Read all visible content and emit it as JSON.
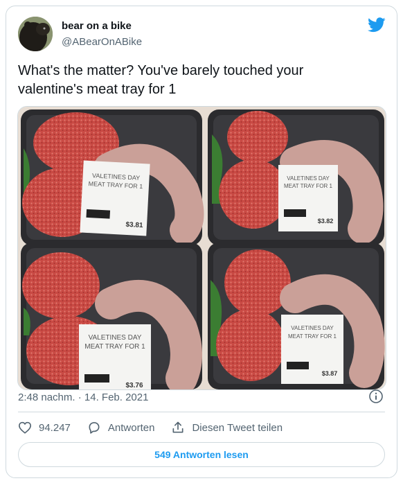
{
  "author": {
    "display_name": "bear on a bike",
    "handle": "@ABearOnABike"
  },
  "tweet": {
    "text_line1": "What's the matter? You've barely touched your",
    "text_line2": "valentine's meat tray for 1",
    "timestamp": "2:48 nachm. · 14. Feb. 2021"
  },
  "media": {
    "trays": [
      {
        "label_line1": "VALETINES DAY",
        "label_line2": "MEAT TRAY FOR 1",
        "price": "$3.81"
      },
      {
        "label_line1": "VALETINES DAY",
        "label_line2": "MEAT TRAY FOR 1",
        "price": "$3.82"
      },
      {
        "label_line1": "VALETINES DAY",
        "label_line2": "MEAT TRAY FOR 1",
        "price": "$3.76"
      },
      {
        "label_line1": "VALETINES DAY",
        "label_line2": "MEAT TRAY FOR 1",
        "price": "$3.87"
      }
    ]
  },
  "actions": {
    "like_count": "94.247",
    "reply_label": "Antworten",
    "share_label": "Diesen Tweet teilen"
  },
  "read_replies_label": "549 Antworten lesen",
  "colors": {
    "accent": "#1d9bf0",
    "secondary_text": "#536471",
    "border": "#cfd9de"
  }
}
